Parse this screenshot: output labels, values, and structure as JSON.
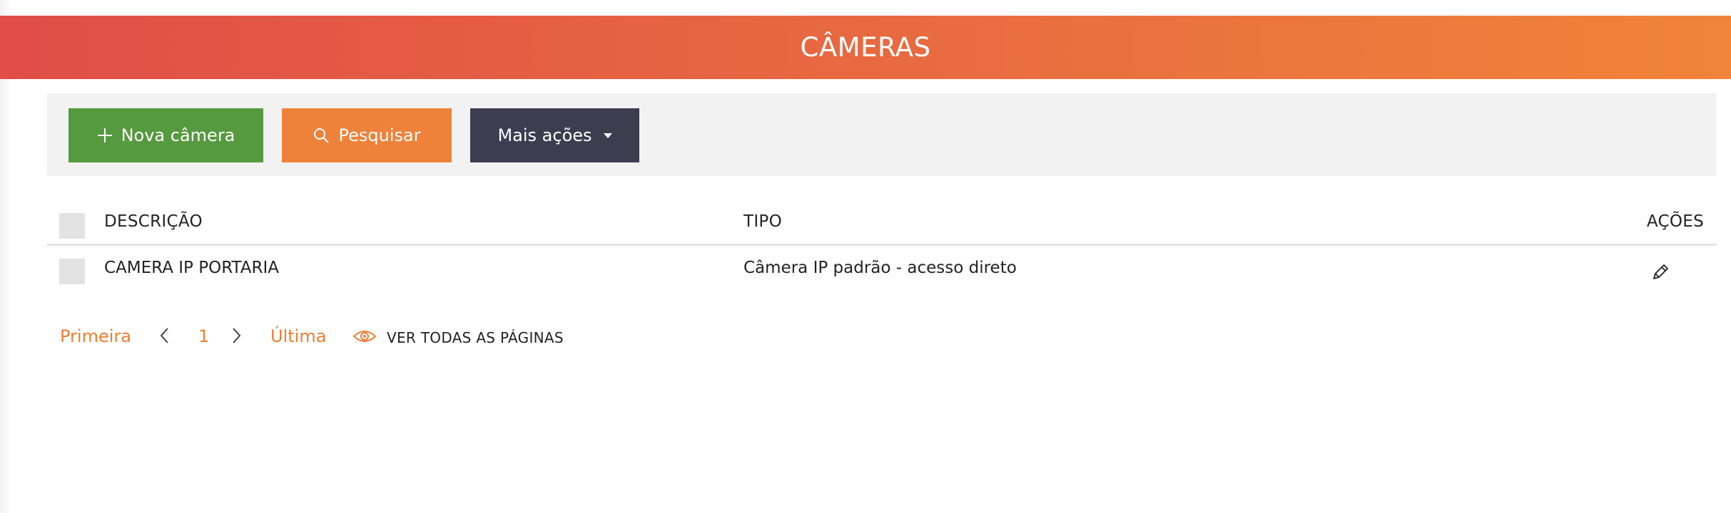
{
  "header": {
    "title": "CÂMERAS",
    "gradient_start": "#e04e47",
    "gradient_end": "#f0843a"
  },
  "toolbar": {
    "new_label": "Nova câmera",
    "new_icon": "plus-icon",
    "new_color": "#559a3e",
    "search_label": "Pesquisar",
    "search_icon": "magnifier-icon",
    "search_color": "#ef823a",
    "more_label": "Mais ações",
    "more_icon": "caret-down-icon",
    "more_color": "#3c3d4f"
  },
  "table": {
    "columns": {
      "descricao": "DESCRIÇÃO",
      "tipo": "TIPO",
      "acoes": "AÇÕES"
    },
    "rows": [
      {
        "descricao": "CAMERA IP PORTARIA",
        "tipo": "Câmera IP padrão - acesso direto",
        "action_icon": "pencil-icon"
      }
    ]
  },
  "pagination": {
    "first": "Primeira",
    "current_page": "1",
    "last": "Última",
    "view_all": "VER TODAS AS PÁGINAS",
    "view_icon": "eye-icon",
    "accent": "#ef7d32"
  }
}
